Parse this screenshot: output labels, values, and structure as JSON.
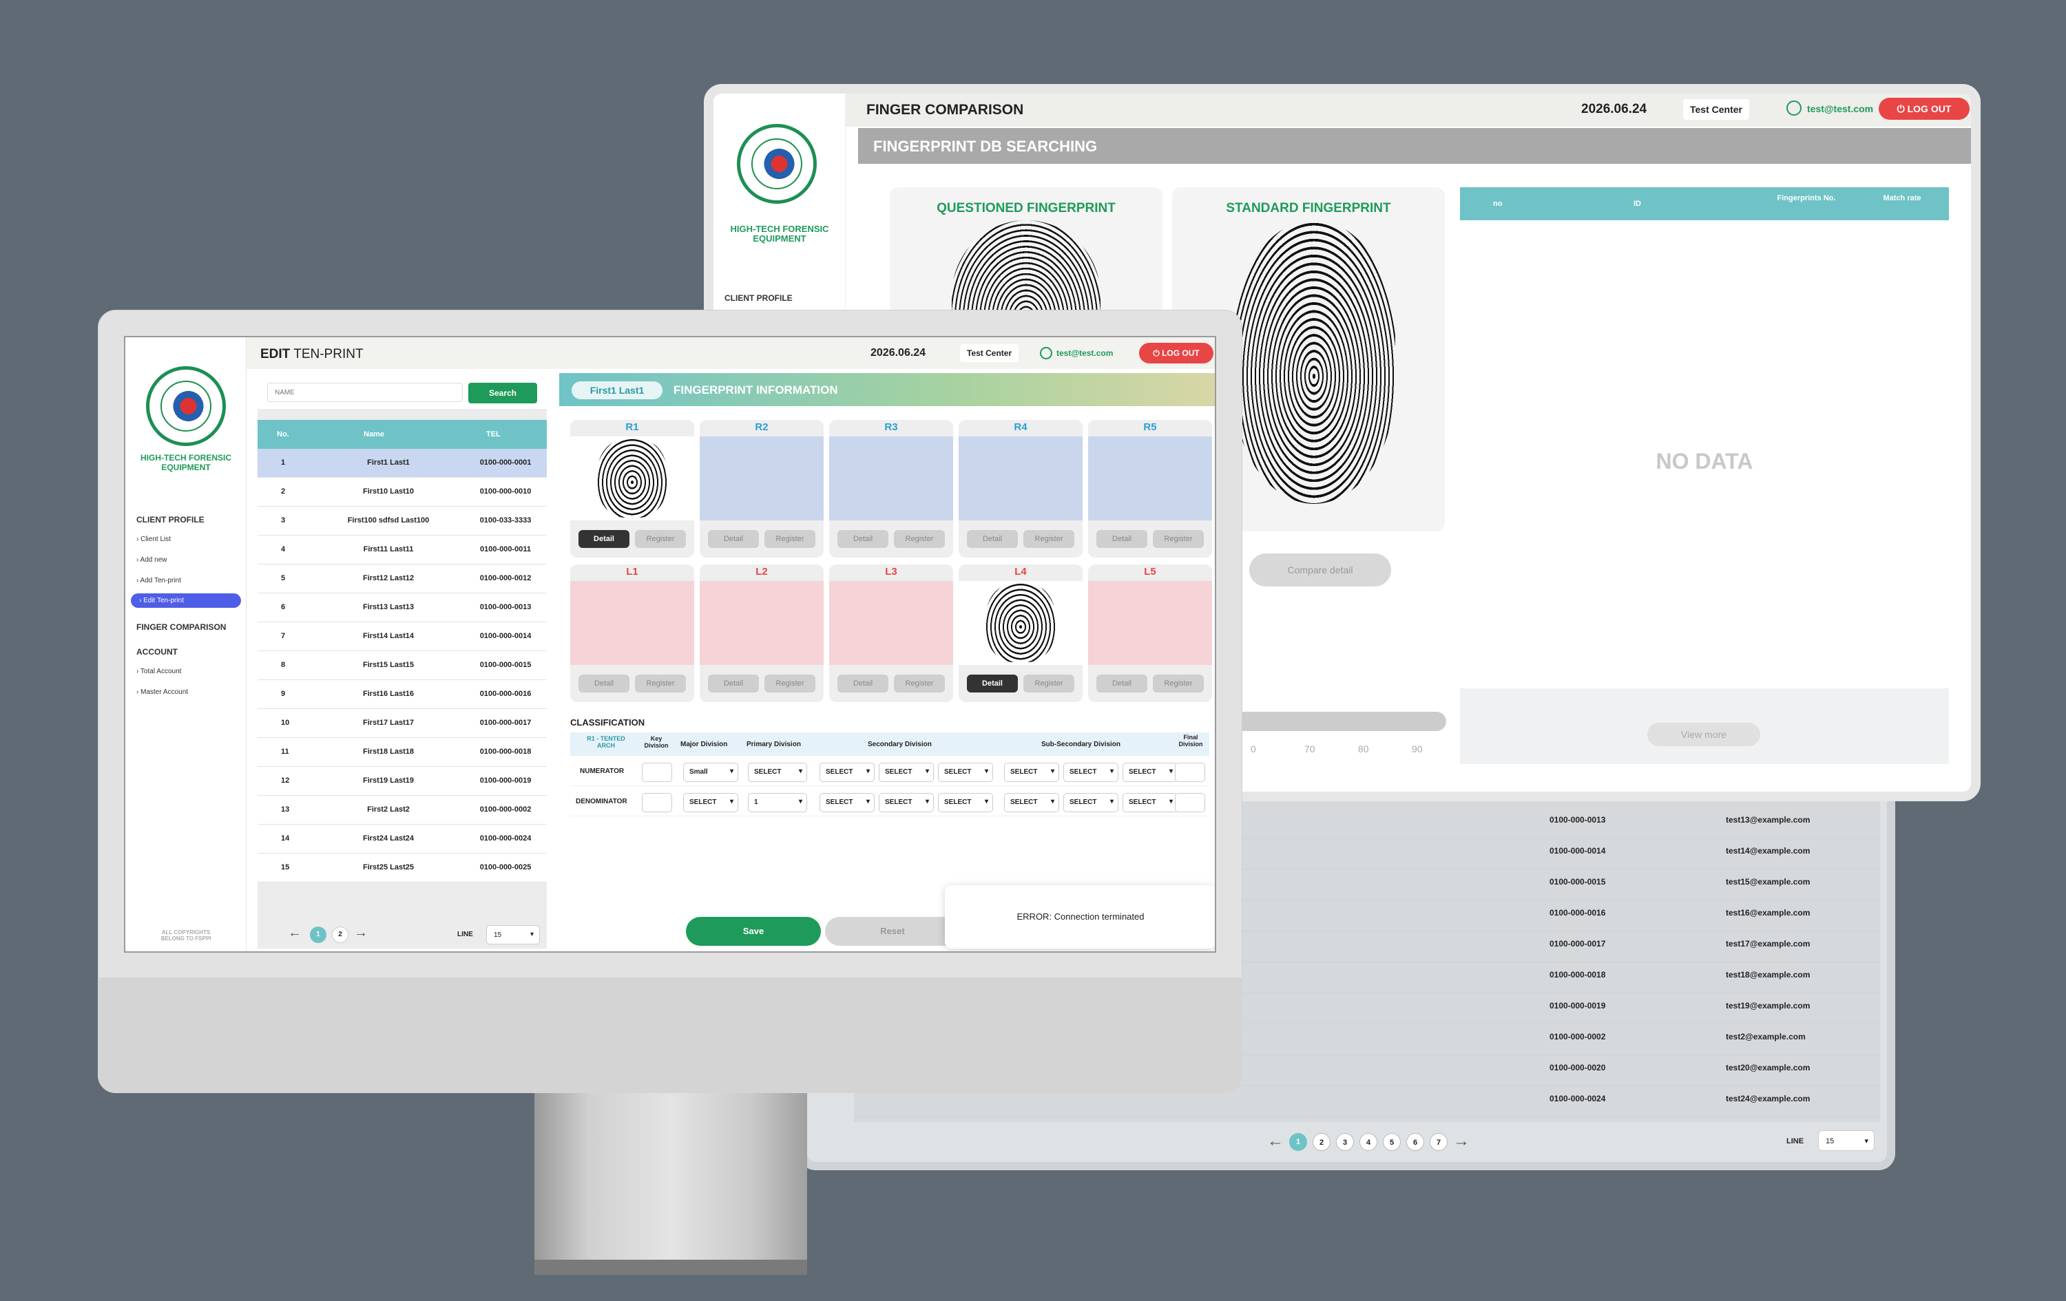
{
  "back": {
    "title": "FINGER COMPARISON",
    "date": "2026.06.24",
    "center": "Test Center",
    "email": "test@test.com",
    "logout": "LOG OUT",
    "section": "FINGERPRINT DB SEARCHING",
    "questioned": "QUESTIONED FINGERPRINT",
    "standard": "STANDARD FINGERPRINT",
    "compare_btn": "Compare detail",
    "result_headers": [
      "no",
      "ID",
      "Fingerprints No.",
      "Match rate"
    ],
    "no_data": "NO DATA",
    "view_more": "View more",
    "scale_ticks": [
      "0",
      "70",
      "80",
      "90"
    ],
    "brand": "HIGH-TECH FORENSIC EQUIPMENT",
    "nav_client": "CLIENT PROFILE",
    "lower_rows": [
      {
        "tel": "0100-000-0013",
        "email": "test13@example.com"
      },
      {
        "tel": "0100-000-0014",
        "email": "test14@example.com"
      },
      {
        "tel": "0100-000-0015",
        "email": "test15@example.com"
      },
      {
        "tel": "0100-000-0016",
        "email": "test16@example.com"
      },
      {
        "tel": "0100-000-0017",
        "email": "test17@example.com"
      },
      {
        "tel": "0100-000-0018",
        "email": "test18@example.com"
      },
      {
        "tel": "0100-000-0019",
        "email": "test19@example.com"
      },
      {
        "tel": "0100-000-0002",
        "email": "test2@example.com"
      },
      {
        "tel": "0100-000-0020",
        "email": "test20@example.com"
      },
      {
        "tel": "0100-000-0024",
        "email": "test24@example.com"
      }
    ],
    "pages": [
      "1",
      "2",
      "3",
      "4",
      "5",
      "6",
      "7"
    ],
    "line_label": "LINE",
    "line_value": "15"
  },
  "front": {
    "title_bold": "EDIT",
    "title_rest": "TEN-PRINT",
    "date": "2026.06.24",
    "center": "Test Center",
    "email": "test@test.com",
    "logout": "LOG OUT",
    "brand": "HIGH-TECH FORENSIC EQUIPMENT",
    "nav": {
      "client_profile": "CLIENT PROFILE",
      "client_list": "› Client List",
      "add_new": "› Add new",
      "add_tenprint": "› Add Ten-print",
      "edit_tenprint": "› Edit Ten-print",
      "finger_comparison": "FINGER COMPARISON",
      "account": "ACCOUNT",
      "total_account": "› Total Account",
      "master_account": "› Master Account"
    },
    "copyright": "ALL COPYRIGHTS BELONG TO FSPPI",
    "search_placeholder": "NAME",
    "search_btn": "Search",
    "table_headers": [
      "No.",
      "Name",
      "TEL"
    ],
    "rows": [
      {
        "no": "1",
        "name": "First1 Last1",
        "tel": "0100-000-0001"
      },
      {
        "no": "2",
        "name": "First10 Last10",
        "tel": "0100-000-0010"
      },
      {
        "no": "3",
        "name": "First100 sdfsd Last100",
        "tel": "0100-033-3333"
      },
      {
        "no": "4",
        "name": "First11 Last11",
        "tel": "0100-000-0011"
      },
      {
        "no": "5",
        "name": "First12 Last12",
        "tel": "0100-000-0012"
      },
      {
        "no": "6",
        "name": "First13 Last13",
        "tel": "0100-000-0013"
      },
      {
        "no": "7",
        "name": "First14 Last14",
        "tel": "0100-000-0014"
      },
      {
        "no": "8",
        "name": "First15 Last15",
        "tel": "0100-000-0015"
      },
      {
        "no": "9",
        "name": "First16 Last16",
        "tel": "0100-000-0016"
      },
      {
        "no": "10",
        "name": "First17 Last17",
        "tel": "0100-000-0017"
      },
      {
        "no": "11",
        "name": "First18 Last18",
        "tel": "0100-000-0018"
      },
      {
        "no": "12",
        "name": "First19 Last19",
        "tel": "0100-000-0019"
      },
      {
        "no": "13",
        "name": "First2 Last2",
        "tel": "0100-000-0002"
      },
      {
        "no": "14",
        "name": "First24 Last24",
        "tel": "0100-000-0024"
      },
      {
        "no": "15",
        "name": "First25 Last25",
        "tel": "0100-000-0025"
      }
    ],
    "pages": [
      "1",
      "2"
    ],
    "line_label": "LINE",
    "line_value": "15",
    "selected_name": "First1 Last1",
    "info_title": "FINGERPRINT INFORMATION",
    "right_fingers": [
      "R1",
      "R2",
      "R3",
      "R4",
      "R5"
    ],
    "left_fingers": [
      "L1",
      "L2",
      "L3",
      "L4",
      "L5"
    ],
    "detail": "Detail",
    "register": "Register",
    "classification": "CLASSIFICATION",
    "class_headers": [
      "R1 - TENTED ARCH",
      "Key Division",
      "Major Division",
      "Primary Division",
      "Secondary Division",
      "Sub-Secondary Division",
      "Final Division"
    ],
    "numerator": "NUMERATOR",
    "denominator": "DENOMINATOR",
    "num_major": "Small",
    "den_major": "SELECT",
    "den_primary": "1",
    "select": "SELECT",
    "save": "Save",
    "reset": "Reset",
    "error": "ERROR: Connection terminated"
  },
  "colors": {
    "teal": "#6fc3c7",
    "green": "#1e9b5a",
    "red": "#e84545",
    "active": "#4f5ee6"
  }
}
